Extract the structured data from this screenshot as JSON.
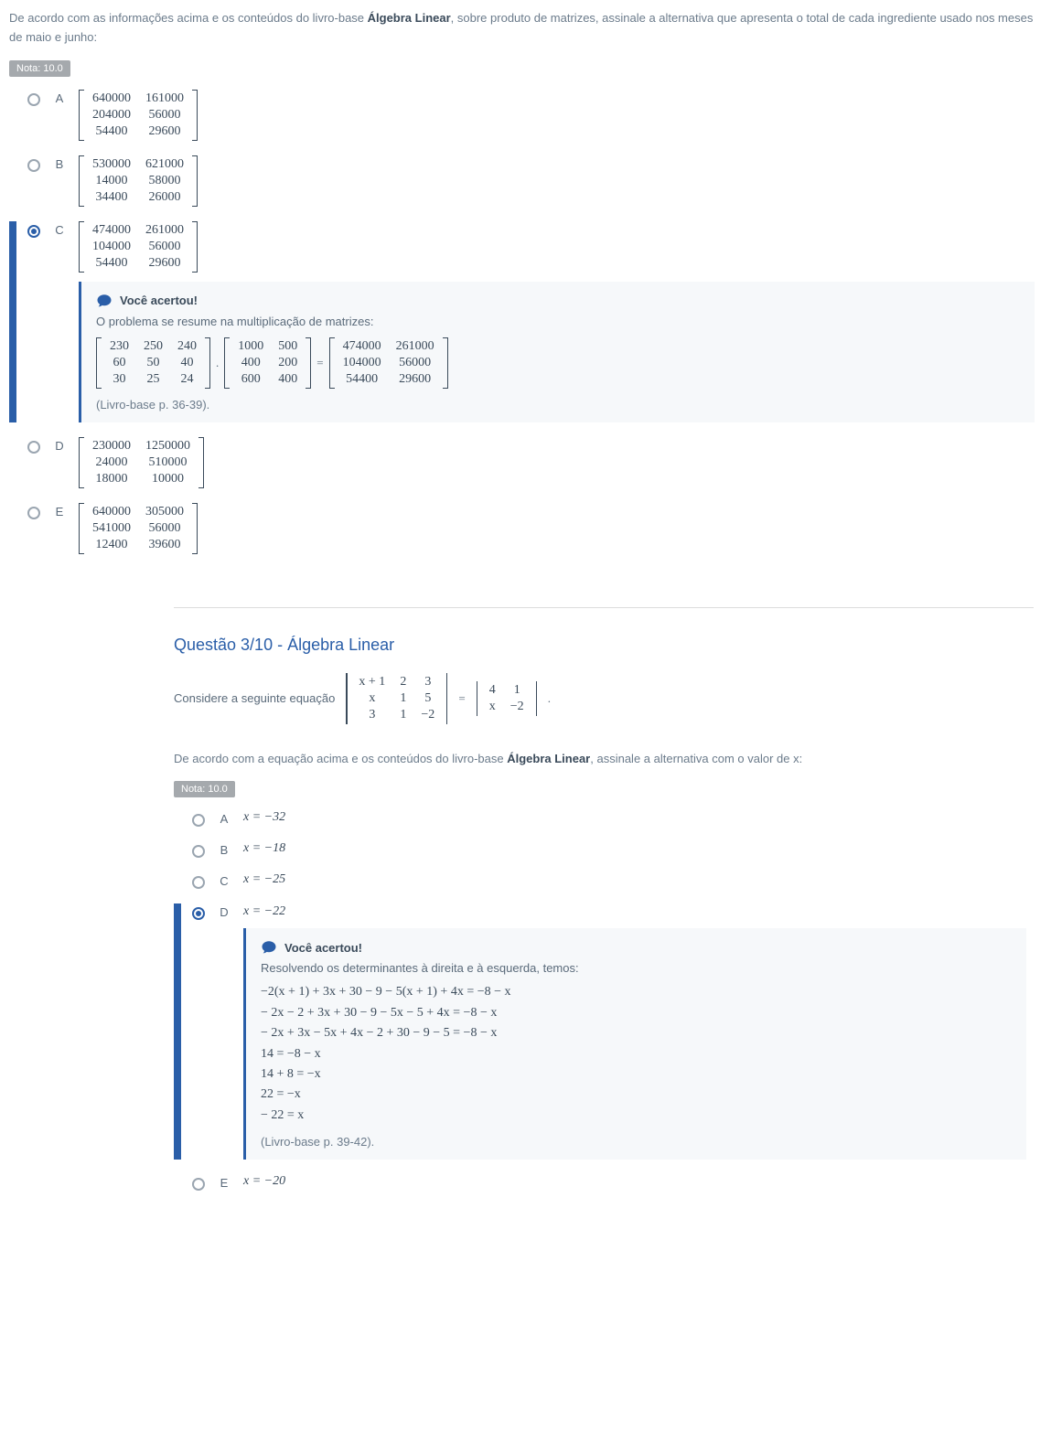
{
  "q2": {
    "intro_prefix": "De acordo com as informações acima e os conteúdos do livro-base ",
    "intro_bold": "Álgebra Linear",
    "intro_suffix": ", sobre produto de matrizes, assinale a alternativa que apresenta o total de cada ingrediente usado nos meses de maio e junho:",
    "nota": "Nota: 10.0",
    "options": {
      "A": [
        [
          "640000",
          "161000"
        ],
        [
          "204000",
          "56000"
        ],
        [
          "54400",
          "29600"
        ]
      ],
      "B": [
        [
          "530000",
          "621000"
        ],
        [
          "14000",
          "58000"
        ],
        [
          "34400",
          "26000"
        ]
      ],
      "C": [
        [
          "474000",
          "261000"
        ],
        [
          "104000",
          "56000"
        ],
        [
          "54400",
          "29600"
        ]
      ],
      "D": [
        [
          "230000",
          "1250000"
        ],
        [
          "24000",
          "510000"
        ],
        [
          "18000",
          "10000"
        ]
      ],
      "E": [
        [
          "640000",
          "305000"
        ],
        [
          "541000",
          "56000"
        ],
        [
          "12400",
          "39600"
        ]
      ]
    },
    "selected": "C",
    "feedback": {
      "title": "Você acertou!",
      "line": "O problema se resume na multiplicação de matrizes:",
      "m1": [
        [
          "230",
          "250",
          "240"
        ],
        [
          "60",
          "50",
          "40"
        ],
        [
          "30",
          "25",
          "24"
        ]
      ],
      "m2": [
        [
          "1000",
          "500"
        ],
        [
          "400",
          "200"
        ],
        [
          "600",
          "400"
        ]
      ],
      "m3": [
        [
          "474000",
          "261000"
        ],
        [
          "104000",
          "56000"
        ],
        [
          "54400",
          "29600"
        ]
      ],
      "ref": "(Livro-base p. 36-39)."
    }
  },
  "q3": {
    "title": "Questão 3/10 - Álgebra Linear",
    "consider": "Considere a seguinte equação",
    "det_left": [
      [
        "x + 1",
        "2",
        "3"
      ],
      [
        "x",
        "1",
        "5"
      ],
      [
        "3",
        "1",
        "−2"
      ]
    ],
    "det_right": [
      [
        "4",
        "1"
      ],
      [
        "x",
        "−2"
      ]
    ],
    "intro_prefix": "De acordo com a equação acima e os conteúdos do livro-base ",
    "intro_bold": "Álgebra Linear",
    "intro_suffix": ", assinale a alternativa com o valor de x:",
    "nota": "Nota: 10.0",
    "options": {
      "A": "x = −32",
      "B": "x = −18",
      "C": "x = −25",
      "D": "x = −22",
      "E": "x = −20"
    },
    "selected": "D",
    "feedback": {
      "title": "Você acertou!",
      "line": "Resolvendo os determinantes à direita e à esquerda, temos:",
      "steps": [
        "−2(x + 1) + 3x + 30 − 9 − 5(x + 1) + 4x = −8 − x",
        "− 2x − 2 + 3x + 30 − 9 − 5x − 5 + 4x = −8 − x",
        "− 2x + 3x − 5x + 4x − 2 + 30 − 9 − 5 = −8 − x",
        "14 = −8 − x",
        "14 + 8 = −x",
        "22 = −x",
        "− 22 = x"
      ],
      "ref": "(Livro-base p. 39-42)."
    }
  }
}
